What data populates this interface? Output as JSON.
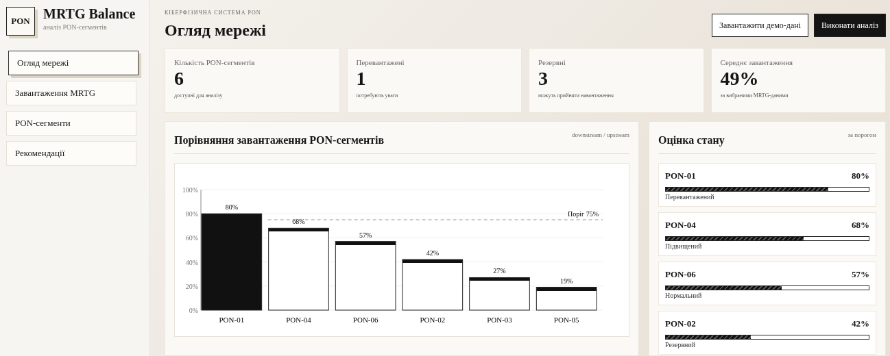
{
  "brand": {
    "logo": "PON",
    "title": "MRTG Balance",
    "subtitle": "аналіз PON-сегментів"
  },
  "sidebar": {
    "items": [
      {
        "label": "Огляд мережі",
        "selected": true
      },
      {
        "label": "Завантаження MRTG",
        "selected": false
      },
      {
        "label": "PON-сегменти",
        "selected": false
      },
      {
        "label": "Рекомендації",
        "selected": false
      }
    ]
  },
  "header": {
    "eyebrow": "КІБЕРФІЗИЧНА СИСТЕМА PON",
    "title": "Огляд мережі",
    "buttons": [
      {
        "label": "Завантажити демо-дані",
        "kind": "outline"
      },
      {
        "label": "Виконати аналіз",
        "kind": "primary"
      }
    ]
  },
  "stats": [
    {
      "label": "Кількість PON-сегментів",
      "value": "6",
      "note": "доступні для аналізу"
    },
    {
      "label": "Перевантажені",
      "value": "1",
      "note": "потребують уваги"
    },
    {
      "label": "Резервні",
      "value": "3",
      "note": "можуть прийняти навантаження"
    },
    {
      "label": "Середнє завантаження",
      "value": "49%",
      "note": "за вибраними MRTG-даними"
    }
  ],
  "comparison": {
    "title": "Порівняння завантаження PON-сегментів",
    "hint": "downstream / upstream",
    "chart_data": {
      "type": "bar",
      "categories": [
        "PON-01",
        "PON-04",
        "PON-06",
        "PON-02",
        "PON-03",
        "PON-05"
      ],
      "values": [
        80,
        68,
        57,
        42,
        27,
        19
      ],
      "ylim": [
        0,
        100
      ],
      "yticks": [
        {
          "value": 0,
          "label": "0%"
        },
        {
          "value": 20,
          "label": "20%"
        },
        {
          "value": 40,
          "label": "40%"
        },
        {
          "value": 60,
          "label": "60%"
        },
        {
          "value": 80,
          "label": "80%"
        },
        {
          "value": 100,
          "label": "100%"
        }
      ],
      "value_labels": [
        "80%",
        "68%",
        "57%",
        "42%",
        "27%",
        "19%"
      ],
      "grid": true,
      "ref_lines": [
        {
          "axis": "y",
          "value": 75,
          "label": "Поріг 75%"
        }
      ]
    }
  },
  "status": {
    "title": "Оцінка стану",
    "hint": "за порогом",
    "items": [
      {
        "name": "PON-01",
        "reading": "80%",
        "level": 0.8,
        "state": "Перевантажений"
      },
      {
        "name": "PON-04",
        "reading": "68%",
        "level": 0.68,
        "state": "Підвищений"
      },
      {
        "name": "PON-06",
        "reading": "57%",
        "level": 0.57,
        "state": "Нормальний"
      },
      {
        "name": "PON-02",
        "reading": "42%",
        "level": 0.42,
        "state": "Резервний"
      }
    ]
  }
}
